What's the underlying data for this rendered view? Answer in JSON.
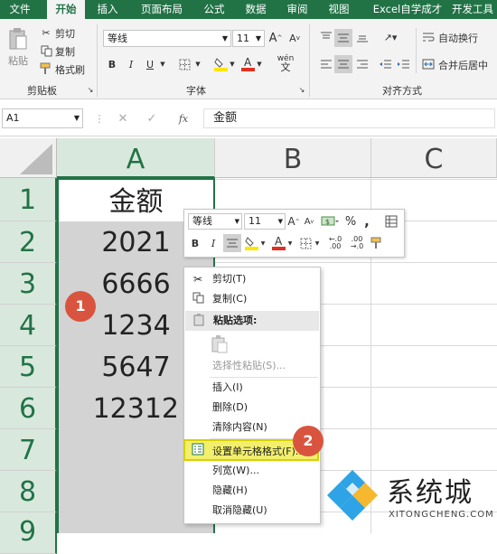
{
  "ribbon": {
    "tabs": [
      "文件",
      "开始",
      "插入",
      "页面布局",
      "公式",
      "数据",
      "审阅",
      "视图",
      "Excel自学成才",
      "开发工具"
    ],
    "active_tab": "开始",
    "clipboard": {
      "paste": "粘贴",
      "cut": "剪切",
      "copy": "复制",
      "format_painter": "格式刷",
      "group_label": "剪贴板"
    },
    "font": {
      "name": "等线",
      "size": "11",
      "group_label": "字体",
      "bold": "B",
      "italic": "I",
      "underline": "U",
      "grow": "A",
      "shrink": "A",
      "phonetic": "wén"
    },
    "alignment": {
      "wrap_text": "自动换行",
      "merge_center": "合并后居中",
      "group_label": "对齐方式"
    }
  },
  "formula_bar": {
    "name_box": "A1",
    "fx": "fx",
    "content": "金额"
  },
  "grid": {
    "columns": [
      "A",
      "B",
      "C"
    ],
    "rows": [
      "1",
      "2",
      "3",
      "4",
      "5",
      "6",
      "7",
      "8",
      "9"
    ],
    "a_values": [
      "金额",
      "2021",
      "6666",
      "1234",
      "5647",
      "12312"
    ]
  },
  "mini_toolbar": {
    "font": "等线",
    "size": "11",
    "grow": "A",
    "shrink": "A",
    "currency": "$",
    "percent": "%",
    "comma": ",",
    "bold": "B",
    "italic": "I",
    "inc_decimal": "+.0\n.00",
    "dec_decimal": ".00\n→.0"
  },
  "context_menu": {
    "items": [
      {
        "label": "剪切(T)",
        "icon": "scissors-icon",
        "enabled": true
      },
      {
        "label": "复制(C)",
        "icon": "copy-icon",
        "enabled": true
      },
      {
        "label": "粘贴选项:",
        "icon": "clipboard-icon",
        "enabled": true,
        "header": true
      },
      {
        "label": "",
        "icon": "paste-option-icon",
        "enabled": false
      },
      {
        "label": "选择性粘贴(S)...",
        "icon": "",
        "enabled": false
      },
      {
        "label": "插入(I)",
        "icon": "",
        "enabled": true
      },
      {
        "label": "删除(D)",
        "icon": "",
        "enabled": true
      },
      {
        "label": "清除内容(N)",
        "icon": "",
        "enabled": true
      },
      {
        "label": "设置单元格格式(F)...",
        "icon": "format-cells-icon",
        "enabled": true,
        "highlighted": true
      },
      {
        "label": "列宽(W)...",
        "icon": "",
        "enabled": true
      },
      {
        "label": "隐藏(H)",
        "icon": "",
        "enabled": true
      },
      {
        "label": "取消隐藏(U)",
        "icon": "",
        "enabled": true
      }
    ]
  },
  "annotations": {
    "step1": "1",
    "step2": "2"
  },
  "watermark": {
    "text": "系统城",
    "url": "XITONGCHENG.COM"
  },
  "colors": {
    "excel_green": "#217346",
    "highlight_yellow": "#f2ef6c",
    "badge_red": "#d9543f",
    "font_red": "#e03020",
    "highlight_fill": "#ffe600"
  }
}
